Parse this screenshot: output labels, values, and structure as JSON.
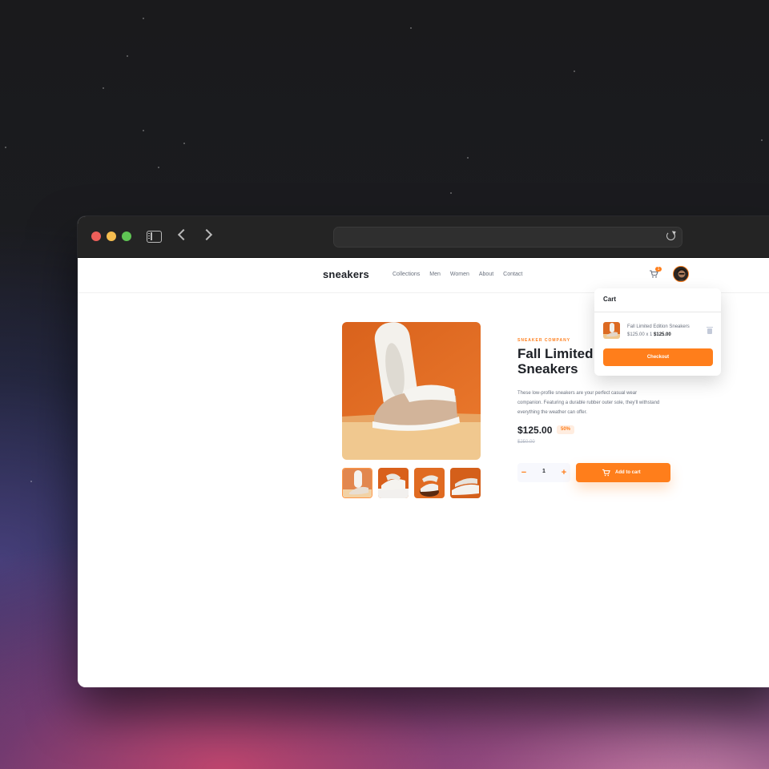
{
  "browser": {
    "address": ""
  },
  "site": {
    "logo": "sneakers",
    "nav": [
      "Collections",
      "Men",
      "Women",
      "About",
      "Contact"
    ],
    "cart_count": "1"
  },
  "cart": {
    "title": "Cart",
    "item_name": "Fall Limited Edition Sneakers",
    "item_qty_price": "$125.00 x 1",
    "item_total": "$125.00",
    "checkout_label": "Checkout"
  },
  "product": {
    "company": "SNEAKER COMPANY",
    "title": "Fall Limited Edition Sneakers",
    "description": "These low-profile sneakers are your perfect casual wear companion. Featuring a durable rubber outer sole, they'll withstand everything the weather can offer.",
    "price": "$125.00",
    "discount": "50%",
    "original_price": "$250.00",
    "quantity": "1",
    "add_to_cart_label": "Add to cart",
    "image_count": 4
  },
  "colors": {
    "accent": "#ff7e1b",
    "dark": "#1d2026",
    "muted": "#69707d"
  },
  "icons": [
    "sidebar-icon",
    "back-icon",
    "forward-icon",
    "reload-icon",
    "cart-icon",
    "trash-icon",
    "minus-icon",
    "plus-icon"
  ]
}
